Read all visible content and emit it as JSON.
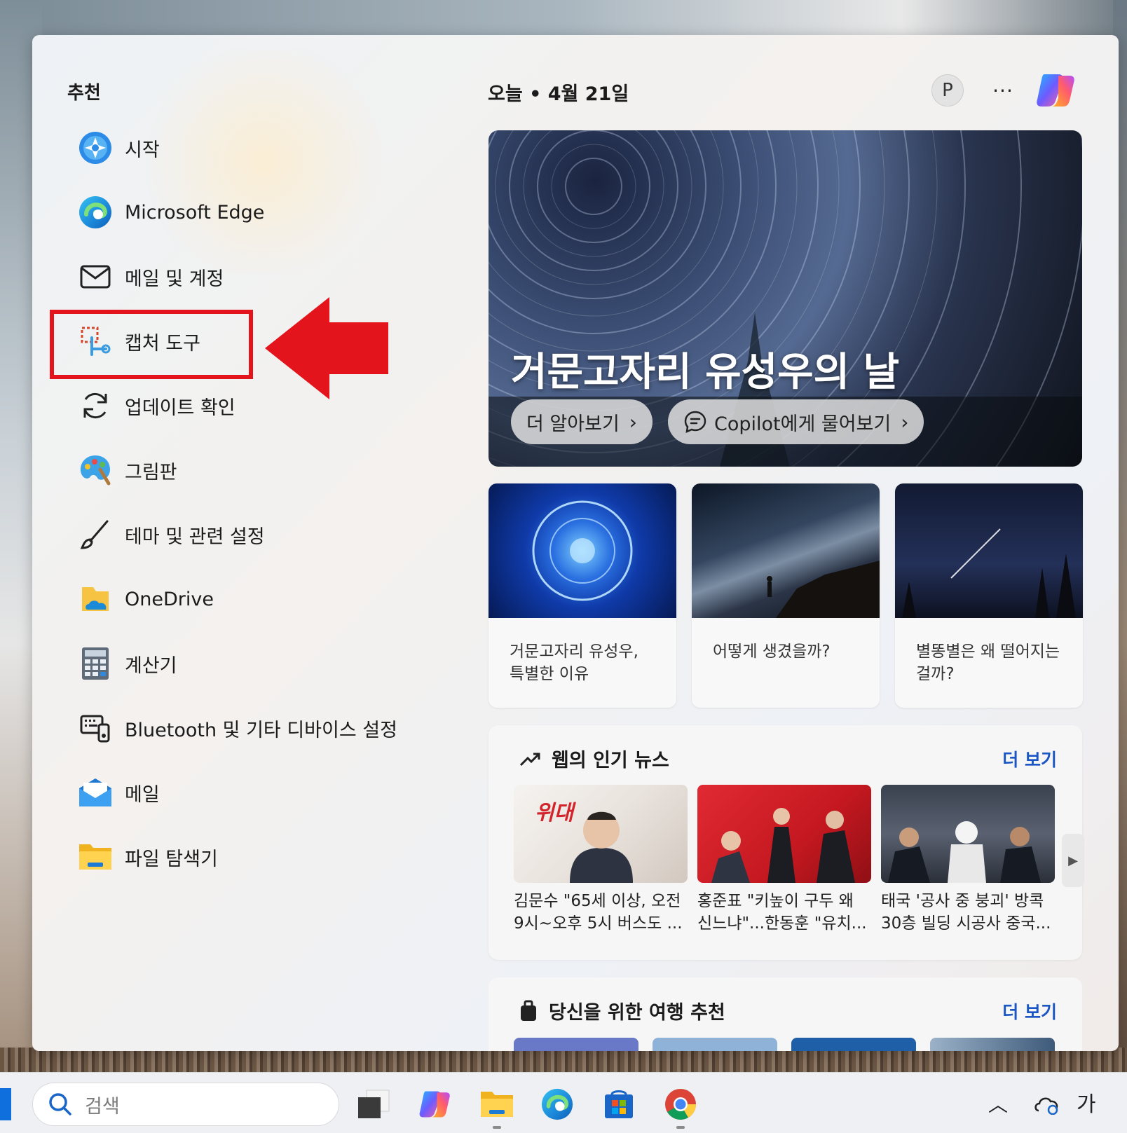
{
  "recommended": {
    "title": "추천",
    "apps": [
      {
        "label": "시작",
        "icon": "get-started-icon"
      },
      {
        "label": "Microsoft Edge",
        "icon": "edge-icon"
      },
      {
        "label": "메일 및 계정",
        "icon": "mail-outline-icon"
      },
      {
        "label": "캡처 도구",
        "icon": "snipping-tool-icon"
      },
      {
        "label": "업데이트 확인",
        "icon": "refresh-icon"
      },
      {
        "label": "그림판",
        "icon": "paint-icon"
      },
      {
        "label": "테마 및 관련 설정",
        "icon": "brush-icon"
      },
      {
        "label": "OneDrive",
        "icon": "onedrive-icon"
      },
      {
        "label": "계산기",
        "icon": "calculator-icon"
      },
      {
        "label": "Bluetooth 및 기타 디바이스 설정",
        "icon": "devices-icon"
      },
      {
        "label": "메일",
        "icon": "mail-app-icon"
      },
      {
        "label": "파일 탐색기",
        "icon": "folder-icon"
      }
    ]
  },
  "feed": {
    "date_title": "오늘 • 4월 21일",
    "profile_initial": "P",
    "more_label": "···",
    "hero": {
      "title": "거문고자리 유성우의 날",
      "learn_more": "더 알아보기",
      "ask_copilot": "Copilot에게 물어보기"
    },
    "cards": [
      {
        "text": "거문고자리 유성우, 특별한 이유"
      },
      {
        "text": "어떻게 생겼을까?"
      },
      {
        "text": "별똥별은 왜 떨어지는 걸까?"
      }
    ],
    "trending": {
      "title": "웹의 인기 뉴스",
      "see_more": "더 보기",
      "items": [
        {
          "line1": "김문수 \"65세 이상, 오전",
          "line2": "9시~오후 5시 버스도 ..."
        },
        {
          "line1": "홍준표 \"키높이 구두 왜",
          "line2": "신느냐\"...한동훈 \"유치..."
        },
        {
          "line1": "태국 '공사 중 붕괴' 방콕",
          "line2": "30층 빌딩 시공사 중국..."
        }
      ]
    },
    "travel": {
      "title": "당신을 위한 여행 추천",
      "see_more": "더 보기"
    }
  },
  "taskbar": {
    "search_placeholder": "검색",
    "ime_label": "가"
  },
  "colors": {
    "highlight": "#e3141b",
    "link": "#1a56c4"
  }
}
